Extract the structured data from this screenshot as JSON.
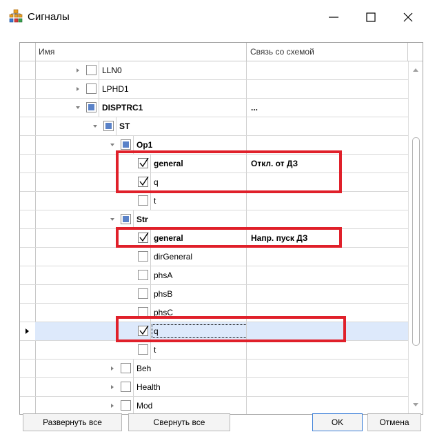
{
  "window": {
    "title": "Сигналы"
  },
  "grid": {
    "columns": [
      "Имя",
      "Связь со схемой"
    ]
  },
  "rows": [
    {
      "level": 2,
      "expander": "collapsed",
      "check": "unchecked",
      "name": "LLN0",
      "bold": false,
      "link": ""
    },
    {
      "level": 2,
      "expander": "collapsed",
      "check": "unchecked",
      "name": "LPHD1",
      "bold": false,
      "link": ""
    },
    {
      "level": 2,
      "expander": "expanded",
      "check": "partial",
      "name": "DISPTRC1",
      "bold": true,
      "link": "..."
    },
    {
      "level": 3,
      "expander": "expanded",
      "check": "partial",
      "name": "ST",
      "bold": true,
      "link": ""
    },
    {
      "level": 4,
      "expander": "expanded",
      "check": "partial",
      "name": "Op1",
      "bold": true,
      "link": ""
    },
    {
      "level": 5,
      "expander": "none",
      "check": "checked",
      "name": "general",
      "bold": true,
      "link": "Откл. от ДЗ"
    },
    {
      "level": 5,
      "expander": "none",
      "check": "checked",
      "name": "q",
      "bold": false,
      "link": ""
    },
    {
      "level": 5,
      "expander": "none",
      "check": "unchecked",
      "name": "t",
      "bold": false,
      "link": ""
    },
    {
      "level": 4,
      "expander": "expanded",
      "check": "partial",
      "name": "Str",
      "bold": true,
      "link": ""
    },
    {
      "level": 5,
      "expander": "none",
      "check": "checked",
      "name": "general",
      "bold": true,
      "link": "Напр. пуск ДЗ"
    },
    {
      "level": 5,
      "expander": "none",
      "check": "unchecked",
      "name": "dirGeneral",
      "bold": false,
      "link": ""
    },
    {
      "level": 5,
      "expander": "none",
      "check": "unchecked",
      "name": "phsA",
      "bold": false,
      "link": ""
    },
    {
      "level": 5,
      "expander": "none",
      "check": "unchecked",
      "name": "phsB",
      "bold": false,
      "link": ""
    },
    {
      "level": 5,
      "expander": "none",
      "check": "unchecked",
      "name": "phsC",
      "bold": false,
      "link": ""
    },
    {
      "level": 5,
      "expander": "none",
      "check": "checked",
      "name": "q",
      "bold": false,
      "link": "",
      "selected": true
    },
    {
      "level": 5,
      "expander": "none",
      "check": "unchecked",
      "name": "t",
      "bold": false,
      "link": ""
    },
    {
      "level": 4,
      "expander": "collapsed",
      "check": "unchecked",
      "name": "Beh",
      "bold": false,
      "link": ""
    },
    {
      "level": 4,
      "expander": "collapsed",
      "check": "unchecked",
      "name": "Health",
      "bold": false,
      "link": ""
    },
    {
      "level": 4,
      "expander": "collapsed",
      "check": "unchecked",
      "name": "Mod",
      "bold": false,
      "link": ""
    }
  ],
  "buttons": {
    "expand_all": "Развернуть все",
    "collapse_all": "Свернуть все",
    "ok": "OK",
    "cancel": "Отмена"
  },
  "colors": {
    "highlight": "#e0202a",
    "partial_check": "#5a82c8",
    "selection": "#dde9fb"
  },
  "icons": {
    "app": "signals-tree-icon",
    "minimize": "minimize-icon",
    "maximize": "maximize-icon",
    "close": "close-icon",
    "check": "checkmark-icon",
    "expand": "chevron-right-icon",
    "collapse": "chevron-down-icon",
    "current_row": "row-pointer-icon"
  }
}
